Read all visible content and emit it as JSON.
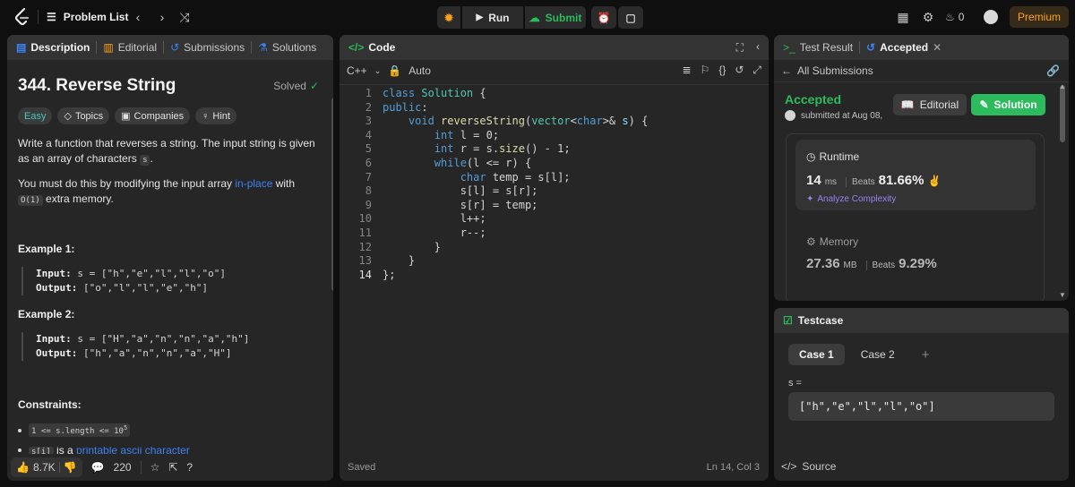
{
  "nav": {
    "problem_list": "Problem List",
    "run": "Run",
    "submit": "Submit",
    "streak_count": "0",
    "premium": "Premium",
    "accent_color": "#ffa116",
    "submit_color": "#2cbb5d"
  },
  "desc": {
    "tabs": [
      "Description",
      "Editorial",
      "Submissions",
      "Solutions"
    ],
    "title": "344. Reverse String",
    "solved": "Solved",
    "chips": [
      "Easy",
      "Topics",
      "Companies",
      "Hint"
    ],
    "p1a": "Write a function that reverses a string. The input string is given as an array of characters ",
    "p1code": "s",
    "p1b": ".",
    "p2a": "You must do this by modifying the input array ",
    "p2link": "in-place",
    "p2b": " with ",
    "p2code": "O(1)",
    "p2c": " extra memory.",
    "ex1_h": "Example 1:",
    "ex1_in_label": "Input:",
    "ex1_in": " s = [\"h\",\"e\",\"l\",\"l\",\"o\"]",
    "ex1_out_label": "Output:",
    "ex1_out": " [\"o\",\"l\",\"l\",\"e\",\"h\"]",
    "ex2_h": "Example 2:",
    "ex2_in_label": "Input:",
    "ex2_in": " s = [\"H\",\"a\",\"n\",\"n\",\"a\",\"h\"]",
    "ex2_out_label": "Output:",
    "ex2_out": " [\"h\",\"a\",\"n\",\"n\",\"a\",\"H\"]",
    "constraints_h": "Constraints:",
    "c1a": "1 <= s.length <= 10",
    "c1sup": "5",
    "c2code": "s[i]",
    "c2a": " is a ",
    "c2link": "printable ascii character",
    "likes": "8.7K",
    "comments": "220"
  },
  "code": {
    "tab": "Code",
    "lang": "C++",
    "auto": "Auto",
    "saved": "Saved",
    "cursor": "Ln 14, Col 3",
    "line_numbers": [
      "1",
      "2",
      "3",
      "4",
      "5",
      "6",
      "7",
      "8",
      "9",
      "10",
      "11",
      "12",
      "13",
      "14"
    ]
  },
  "result": {
    "tabs": [
      "Test Result",
      "Accepted"
    ],
    "all_submissions": "All Submissions",
    "status": "Accepted",
    "submitted": "submitted at Aug 08,",
    "editorial_btn": "Editorial",
    "solution_btn": "Solution",
    "runtime_label": "Runtime",
    "runtime_value": "14",
    "runtime_unit": "ms",
    "beats_label": "Beats",
    "runtime_beats": "81.66%",
    "analyze": "Analyze Complexity",
    "memory_label": "Memory",
    "memory_value": "27.36",
    "memory_unit": "MB",
    "memory_beats": "9.29%"
  },
  "testcase": {
    "title": "Testcase",
    "cases": [
      "Case 1",
      "Case 2"
    ],
    "var": "s =",
    "value": "[\"h\",\"e\",\"l\",\"l\",\"o\"]",
    "source": "Source"
  }
}
